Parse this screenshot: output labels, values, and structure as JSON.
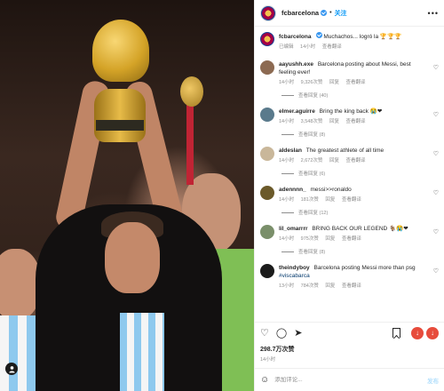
{
  "post": {
    "username": "fcbarcelona",
    "follow_label": "关注",
    "more_label": "•••"
  },
  "caption": {
    "username": "fcbarcelona",
    "text": "Muchachos... logró la 🏆🏆🏆",
    "edited": "已编辑",
    "time": "14小时",
    "translate": "查看翻译"
  },
  "comments": [
    {
      "username": "aayushh.exe",
      "text": "Barcelona posting about Messi, best feeling ever!",
      "time": "14小时",
      "likes": "9,326次赞",
      "reply": "回复",
      "translate": "查看翻译",
      "replies": "查看回复 (40)",
      "avatar_color": "#8c6a52"
    },
    {
      "username": "elmer.aguirre",
      "text": "Bring the king back 😭❤",
      "time": "14小时",
      "likes": "3,548次赞",
      "reply": "回复",
      "translate": "查看翻译",
      "replies": "查看回复 (8)",
      "avatar_color": "#5a7a8c"
    },
    {
      "username": "aldeslan",
      "text": "The greatest athlete of all time",
      "time": "14小时",
      "likes": "2,672次赞",
      "reply": "回复",
      "translate": "查看翻译",
      "replies": "查看回复 (6)",
      "avatar_color": "#c9b79a"
    },
    {
      "username": "adennnn_",
      "text": "messi>>ronaldo",
      "time": "14小时",
      "likes": "181次赞",
      "reply": "回复",
      "translate": "查看翻译",
      "replies": "查看回复 (12)",
      "avatar_color": "#6b5a2a"
    },
    {
      "username": "lil_omarrrr",
      "text": "BRING BACK OUR LEGEND 🐐😭❤",
      "time": "14小时",
      "likes": "975次赞",
      "reply": "回复",
      "translate": "查看翻译",
      "replies": "查看回复 (8)",
      "avatar_color": "#7a8f6a"
    },
    {
      "username": "theindyboy",
      "text": "Barcelona posting Messi more than psg",
      "hashtag": "#viscabarca",
      "time": "13小时",
      "likes": "784次赞",
      "reply": "回复",
      "translate": "查看翻译",
      "replies": "",
      "avatar_color": "#1b1b1b"
    }
  ],
  "footer": {
    "views": "298.7万次赞",
    "time": "14小时",
    "comment_placeholder": "添加评论...",
    "post_label": "发布"
  }
}
